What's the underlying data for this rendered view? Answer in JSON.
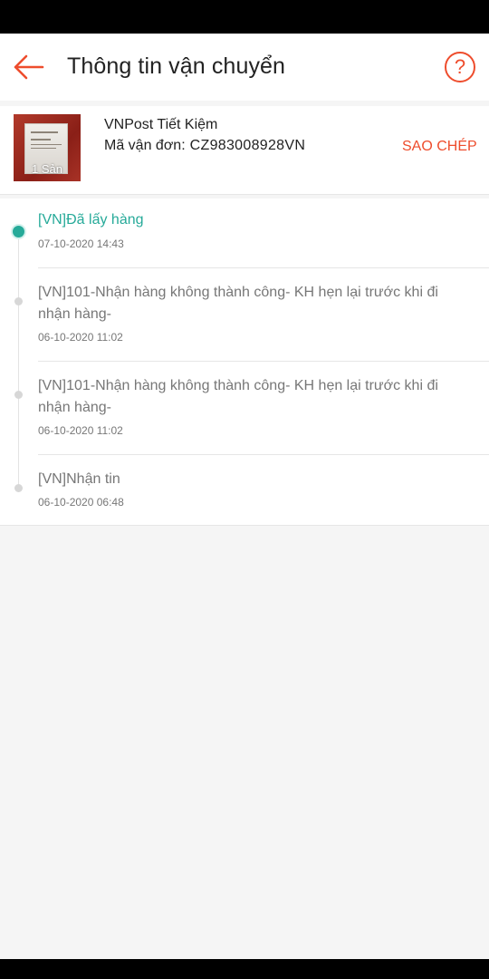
{
  "header": {
    "title": "Thông tin vận chuyển",
    "help_label": "?"
  },
  "shipment": {
    "carrier": "VNPost Tiết Kiệm",
    "tracking_label": "Mã vận đơn:",
    "tracking_code": "CZ983008928VN",
    "copy_label": "SAO CHÉP",
    "product_count_label": "1 Sản"
  },
  "timeline": [
    {
      "status": "[VN]Đã lấy hàng",
      "time": "07-10-2020 14:43",
      "active": true
    },
    {
      "status": "[VN]101-Nhận hàng không thành công- KH hẹn lại trước khi đi nhận hàng-",
      "time": "06-10-2020 11:02",
      "active": false
    },
    {
      "status": "[VN]101-Nhận hàng không thành công- KH hẹn lại trước khi đi nhận hàng-",
      "time": "06-10-2020 11:02",
      "active": false
    },
    {
      "status": "[VN]Nhận tin",
      "time": "06-10-2020 06:48",
      "active": false
    }
  ],
  "colors": {
    "accent": "#ee4d2d",
    "active": "#26aa99",
    "muted": "#777777"
  },
  "icons": {
    "back": "arrow-left-icon",
    "help": "question-circle-icon"
  }
}
